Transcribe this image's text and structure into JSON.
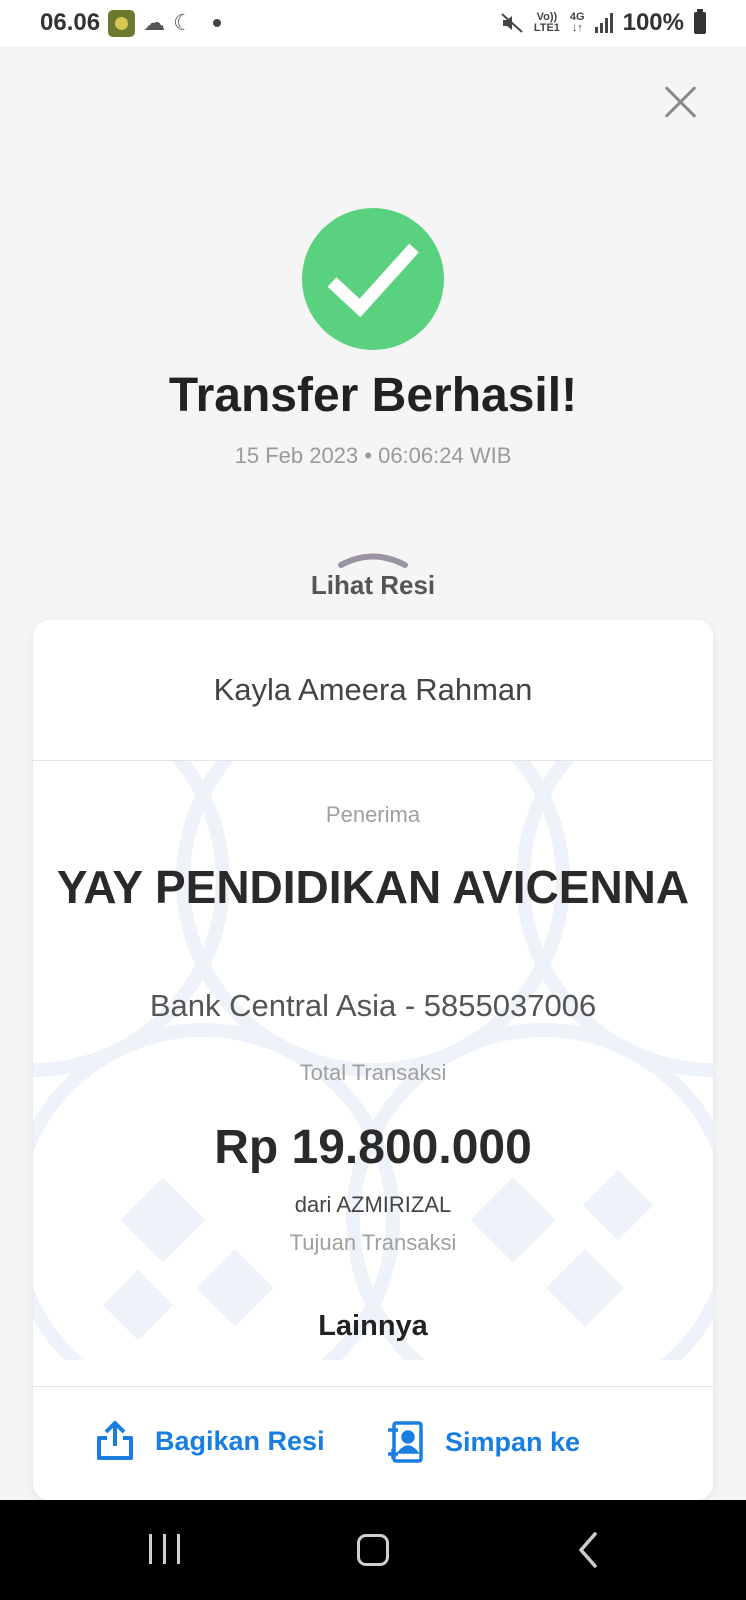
{
  "status_bar": {
    "time": "06.06",
    "volte": "Vo))",
    "lte": "LTE1",
    "network": "4G",
    "battery": "100%"
  },
  "success": {
    "title": "Transfer Berhasil!",
    "datetime": "15 Feb 2023 • 06:06:24 WIB",
    "color": "#5ad17f"
  },
  "receipt_toggle": {
    "label": "Lihat Resi"
  },
  "receipt": {
    "sender_name": "Kayla Ameera Rahman",
    "recipient_label": "Penerima",
    "recipient_name": "YAY PENDIDIKAN AVICENNA",
    "recipient_bank": "Bank Central Asia - 5855037006",
    "total_label": "Total Transaksi",
    "total_amount": "Rp 19.800.000",
    "source": "dari AZMIRIZAL",
    "purpose_label": "Tujuan Transaksi",
    "purpose_value": "Lainnya"
  },
  "actions": {
    "share_label": "Bagikan Resi",
    "save_label": "Simpan ke",
    "accent": "#1a7ee0"
  },
  "icons": [
    "close-icon",
    "checkmark-icon",
    "chevron-up-icon",
    "share-icon",
    "save-contact-icon",
    "recent-apps-icon",
    "home-icon",
    "back-icon"
  ]
}
